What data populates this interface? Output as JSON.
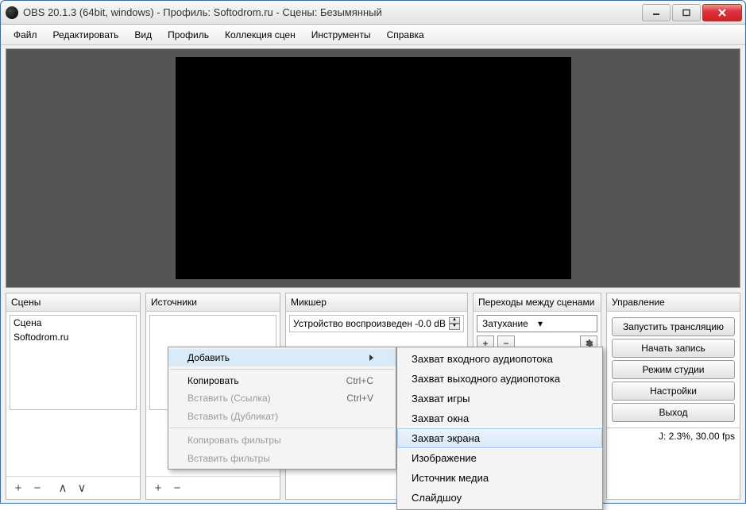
{
  "title": "OBS 20.1.3 (64bit, windows) - Профиль: Softodrom.ru - Сцены: Безымянный",
  "menubar": [
    "Файл",
    "Редактировать",
    "Вид",
    "Профиль",
    "Коллекция сцен",
    "Инструменты",
    "Справка"
  ],
  "panels": {
    "scenes": {
      "title": "Сцены",
      "items": [
        "Сцена",
        "Softodrom.ru"
      ]
    },
    "sources": {
      "title": "Источники",
      "items": []
    },
    "mixer": {
      "title": "Микшер",
      "device": "Устройство воспроизведени",
      "db": "-0.0 dB"
    },
    "transitions": {
      "title": "Переходы между сценами",
      "selected": "Затухание"
    },
    "controls": {
      "title": "Управление",
      "buttons": [
        "Запустить трансляцию",
        "Начать запись",
        "Режим студии",
        "Настройки",
        "Выход"
      ]
    }
  },
  "status": "J: 2.3%, 30.00 fps",
  "context1": {
    "add": "Добавить",
    "items": [
      {
        "label": "Копировать",
        "shortcut": "Ctrl+C",
        "disabled": false
      },
      {
        "label": "Вставить (Ссылка)",
        "shortcut": "Ctrl+V",
        "disabled": true
      },
      {
        "label": "Вставить (Дубликат)",
        "shortcut": "",
        "disabled": true
      }
    ],
    "items2": [
      {
        "label": "Копировать фильтры",
        "disabled": true
      },
      {
        "label": "Вставить фильтры",
        "disabled": true
      }
    ]
  },
  "context2": [
    "Захват входного аудиопотока",
    "Захват выходного аудиопотока",
    "Захват игры",
    "Захват окна",
    "Захват экрана",
    "Изображение",
    "Источник медиа",
    "Слайдшоу"
  ],
  "context2_highlight": 4
}
